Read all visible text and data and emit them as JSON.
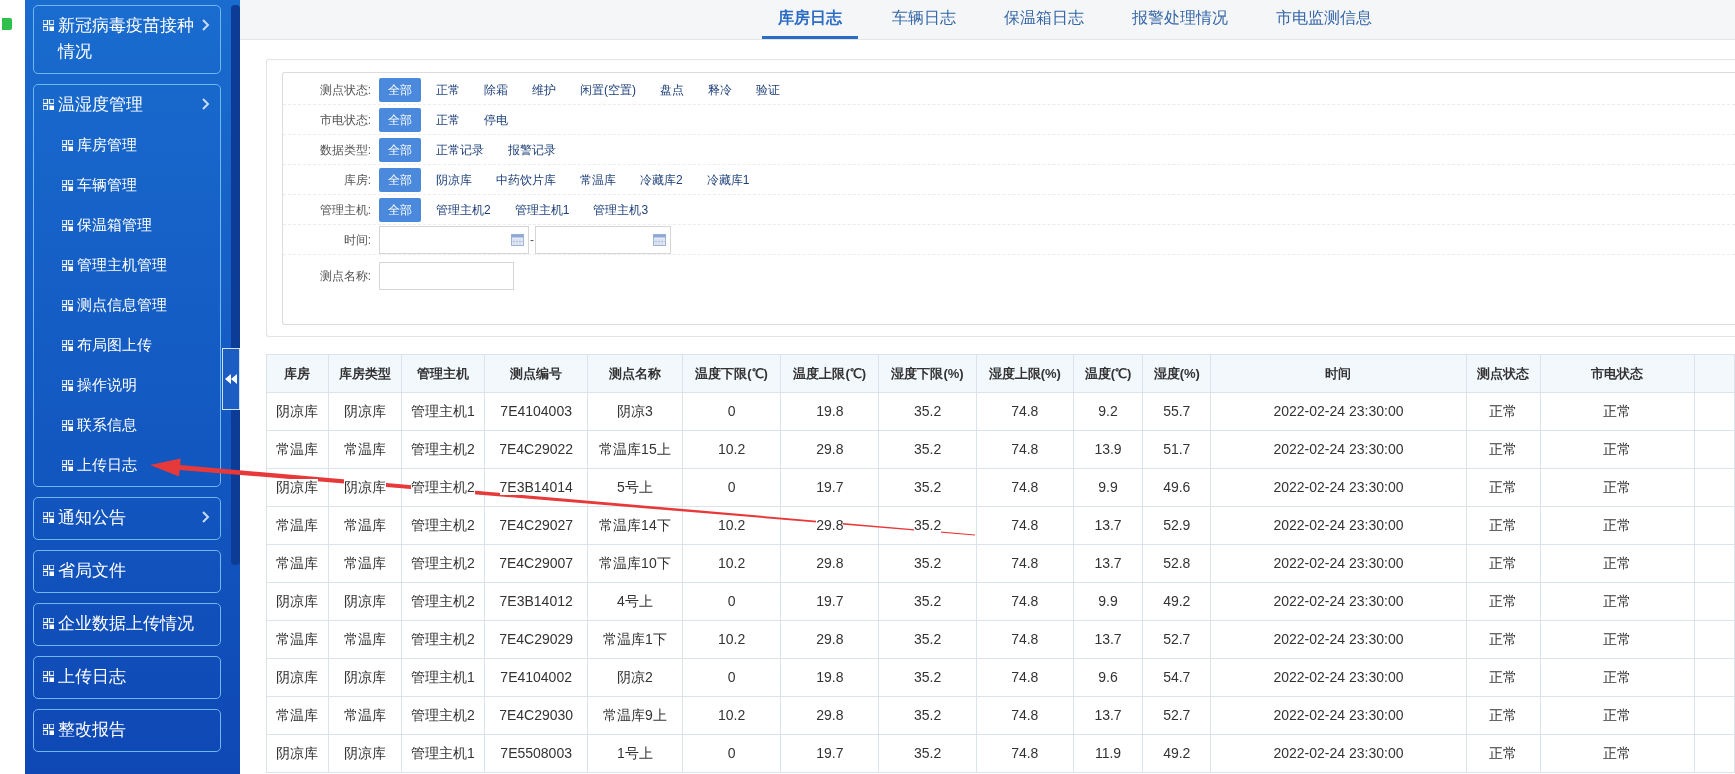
{
  "sidebar": {
    "items": [
      {
        "label": "新冠病毒疫苗接种情况",
        "chevron": true
      },
      {
        "label": "温湿度管理",
        "chevron": true,
        "children": [
          {
            "label": "库房管理"
          },
          {
            "label": "车辆管理"
          },
          {
            "label": "保温箱管理"
          },
          {
            "label": "管理主机管理"
          },
          {
            "label": "测点信息管理"
          },
          {
            "label": "布局图上传"
          },
          {
            "label": "操作说明"
          },
          {
            "label": "联系信息"
          },
          {
            "label": "上传日志"
          }
        ]
      },
      {
        "label": "通知公告",
        "chevron": true
      },
      {
        "label": "省局文件",
        "chevron": false
      },
      {
        "label": "企业数据上传情况",
        "chevron": false
      },
      {
        "label": "上传日志",
        "chevron": false
      },
      {
        "label": "整改报告",
        "chevron": false
      }
    ]
  },
  "tabs": [
    {
      "label": "库房日志",
      "selected": true
    },
    {
      "label": "车辆日志",
      "selected": false
    },
    {
      "label": "保温箱日志",
      "selected": false
    },
    {
      "label": "报警处理情况",
      "selected": false
    },
    {
      "label": "市电监测信息",
      "selected": false
    }
  ],
  "filters": [
    {
      "kind": "options",
      "label": "测点状态:",
      "options": [
        {
          "label": "全部",
          "selected": true
        },
        {
          "label": "正常",
          "selected": false
        },
        {
          "label": "除霜",
          "selected": false
        },
        {
          "label": "维护",
          "selected": false
        },
        {
          "label": "闲置(空置)",
          "selected": false
        },
        {
          "label": "盘点",
          "selected": false
        },
        {
          "label": "释冷",
          "selected": false
        },
        {
          "label": "验证",
          "selected": false
        }
      ]
    },
    {
      "kind": "options",
      "label": "市电状态:",
      "options": [
        {
          "label": "全部",
          "selected": true
        },
        {
          "label": "正常",
          "selected": false
        },
        {
          "label": "停电",
          "selected": false
        }
      ]
    },
    {
      "kind": "options",
      "label": "数据类型:",
      "options": [
        {
          "label": "全部",
          "selected": true
        },
        {
          "label": "正常记录",
          "selected": false
        },
        {
          "label": "报警记录",
          "selected": false
        }
      ]
    },
    {
      "kind": "options",
      "label": "库房:",
      "options": [
        {
          "label": "全部",
          "selected": true
        },
        {
          "label": "阴凉库",
          "selected": false
        },
        {
          "label": "中药饮片库",
          "selected": false
        },
        {
          "label": "常温库",
          "selected": false
        },
        {
          "label": "冷藏库2",
          "selected": false
        },
        {
          "label": "冷藏库1",
          "selected": false
        }
      ]
    },
    {
      "kind": "options",
      "label": "管理主机:",
      "options": [
        {
          "label": "全部",
          "selected": true
        },
        {
          "label": "管理主机2",
          "selected": false
        },
        {
          "label": "管理主机1",
          "selected": false
        },
        {
          "label": "管理主机3",
          "selected": false
        }
      ]
    },
    {
      "kind": "date_range",
      "label": "时间:",
      "separator": "-"
    },
    {
      "kind": "text",
      "label": "测点名称:"
    }
  ],
  "table": {
    "columns": [
      "库房",
      "库房类型",
      "管理主机",
      "测点编号",
      "测点名称",
      "温度下限(℃)",
      "温度上限(℃)",
      "湿度下限(%)",
      "湿度上限(%)",
      "温度(℃)",
      "湿度(%)",
      "时间",
      "测点状态",
      "市电状态"
    ],
    "rows": [
      [
        "阴凉库",
        "阴凉库",
        "管理主机1",
        "7E4104003",
        "阴凉3",
        "0",
        "19.8",
        "35.2",
        "74.8",
        "9.2",
        "55.7",
        "2022-02-24 23:30:00",
        "正常",
        "正常"
      ],
      [
        "常温库",
        "常温库",
        "管理主机2",
        "7E4C29022",
        "常温库15上",
        "10.2",
        "29.8",
        "35.2",
        "74.8",
        "13.9",
        "51.7",
        "2022-02-24 23:30:00",
        "正常",
        "正常"
      ],
      [
        "阴凉库",
        "阴凉库",
        "管理主机2",
        "7E3B14014",
        "5号上",
        "0",
        "19.7",
        "35.2",
        "74.8",
        "9.9",
        "49.6",
        "2022-02-24 23:30:00",
        "正常",
        "正常"
      ],
      [
        "常温库",
        "常温库",
        "管理主机2",
        "7E4C29027",
        "常温库14下",
        "10.2",
        "29.8",
        "35.2",
        "74.8",
        "13.7",
        "52.9",
        "2022-02-24 23:30:00",
        "正常",
        "正常"
      ],
      [
        "常温库",
        "常温库",
        "管理主机2",
        "7E4C29007",
        "常温库10下",
        "10.2",
        "29.8",
        "35.2",
        "74.8",
        "13.7",
        "52.8",
        "2022-02-24 23:30:00",
        "正常",
        "正常"
      ],
      [
        "阴凉库",
        "阴凉库",
        "管理主机2",
        "7E3B14012",
        "4号上",
        "0",
        "19.7",
        "35.2",
        "74.8",
        "9.9",
        "49.2",
        "2022-02-24 23:30:00",
        "正常",
        "正常"
      ],
      [
        "常温库",
        "常温库",
        "管理主机2",
        "7E4C29029",
        "常温库1下",
        "10.2",
        "29.8",
        "35.2",
        "74.8",
        "13.7",
        "52.7",
        "2022-02-24 23:30:00",
        "正常",
        "正常"
      ],
      [
        "阴凉库",
        "阴凉库",
        "管理主机1",
        "7E4104002",
        "阴凉2",
        "0",
        "19.8",
        "35.2",
        "74.8",
        "9.6",
        "54.7",
        "2022-02-24 23:30:00",
        "正常",
        "正常"
      ],
      [
        "常温库",
        "常温库",
        "管理主机2",
        "7E4C29030",
        "常温库9上",
        "10.2",
        "29.8",
        "35.2",
        "74.8",
        "13.7",
        "52.7",
        "2022-02-24 23:30:00",
        "正常",
        "正常"
      ],
      [
        "阴凉库",
        "阴凉库",
        "管理主机1",
        "7E5508003",
        "1号上",
        "0",
        "19.7",
        "35.2",
        "74.8",
        "11.9",
        "49.2",
        "2022-02-24 23:30:00",
        "正常",
        "正常"
      ]
    ]
  }
}
